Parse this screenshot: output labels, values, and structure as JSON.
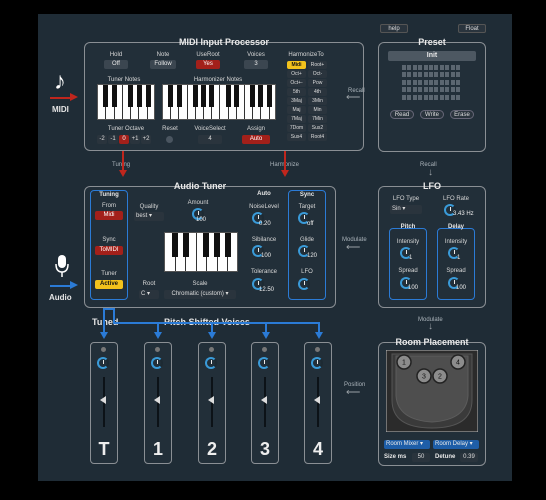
{
  "top": {
    "help": "help",
    "float": "Float"
  },
  "left": {
    "midi_label": "MIDI",
    "audio_label": "Audio"
  },
  "midi_input": {
    "title": "MIDI Input Processor",
    "hold": {
      "label": "Hold",
      "value": "Off"
    },
    "note": {
      "label": "Note",
      "value": "Follow"
    },
    "useroot": {
      "label": "UseRoot",
      "value": "Yes"
    },
    "voices": {
      "label": "Voices",
      "value": "3"
    },
    "tuner_notes": "Tuner Notes",
    "harmonizer_notes": "Harmonizer Notes",
    "tuner_octave": {
      "label": "Tuner Octave",
      "options": [
        "-2",
        "-1",
        "0",
        "+1",
        "+2"
      ]
    },
    "reset": "Reset",
    "voiceselect": {
      "label": "VoiceSelect",
      "value": "4"
    },
    "assign": {
      "label": "Assign",
      "value": "Auto"
    },
    "harmonize_to": {
      "label": "HarmonizeTo",
      "options": [
        "Midi",
        "Root+",
        "Oct+",
        "Oct-",
        "Oct+-",
        "Pow",
        "5th",
        "4th",
        "3Maj",
        "3Min",
        "Maj",
        "Min",
        "7Maj",
        "7Min",
        "7Dom",
        "Sus2",
        "Sus4",
        "Root4"
      ]
    }
  },
  "preset": {
    "title": "Preset",
    "init": "Init",
    "read": "Read",
    "write": "Write",
    "erase": "Erase"
  },
  "flows": {
    "recall_top": "Recall",
    "tuning": "Tuning",
    "harmonize": "Harmonize",
    "recall_mid": "Recall",
    "modulate_mid": "Modulate",
    "modulate_bot": "Modulate",
    "position": "Position"
  },
  "audio_tuner": {
    "title": "Audio Tuner",
    "tuning": "Tuning",
    "from": {
      "label": "From",
      "value": "Midi"
    },
    "sync": {
      "label": "Sync",
      "value": "ToMIDI"
    },
    "tuner": {
      "label": "Tuner",
      "value": "Active"
    },
    "quality": {
      "label": "Quality",
      "value": "best"
    },
    "amount": {
      "label": "Amount",
      "value": "100"
    },
    "root": {
      "label": "Root",
      "value": "C"
    },
    "scale": {
      "label": "Scale",
      "value": "Chromatic (custom)"
    },
    "auto": "Auto",
    "noise_level": {
      "label": "NoiseLevel",
      "value": "0.20"
    },
    "sibilance": {
      "label": "Sibilance",
      "value": "100"
    },
    "tolerance": {
      "label": "Tolerance",
      "value": "12.50"
    },
    "sync_title": "Sync",
    "target": {
      "label": "Target",
      "value": "off"
    },
    "glide": {
      "label": "Glide",
      "value": "120"
    },
    "lfo": "LFO"
  },
  "lfo": {
    "title": "LFO",
    "type": {
      "label": "LFO Type",
      "value": "Sin"
    },
    "rate": {
      "label": "LFO Rate",
      "value": "3.43 Hz"
    },
    "pitch": {
      "title": "Pitch",
      "intensity": {
        "label": "Intensity",
        "value": "1"
      },
      "spread": {
        "label": "Spread",
        "value": "100"
      }
    },
    "delay": {
      "title": "Delay",
      "intensity": {
        "label": "Intensity",
        "value": "1"
      },
      "spread": {
        "label": "Spread",
        "value": "100"
      }
    }
  },
  "voices": {
    "tuned": "Tuned",
    "pitch_shifted": "Pitch Shifted Voices",
    "strips": [
      "T",
      "1",
      "2",
      "3",
      "4"
    ]
  },
  "room": {
    "title": "Room Placement",
    "pucks": [
      "1",
      "2",
      "3",
      "4"
    ],
    "mixer": "Room Mixer",
    "delay": "Room Delay",
    "size_label": "Size ms",
    "size_value": "50",
    "detune_label": "Detune",
    "detune_value": "0.39"
  },
  "colors": {
    "accent_blue": "#2b7bd6",
    "accent_red": "#a3201a",
    "accent_yellow": "#f2c21c",
    "panel": "#1f2c36"
  }
}
